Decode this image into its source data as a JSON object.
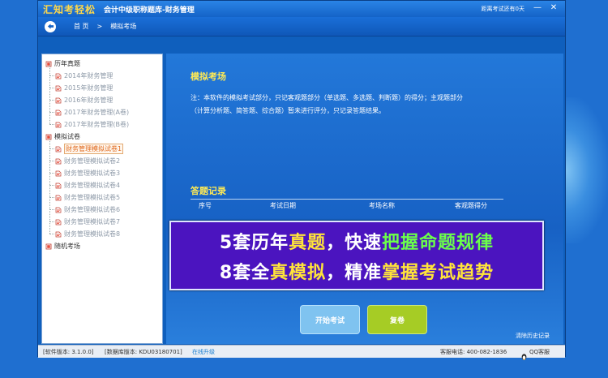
{
  "window": {
    "logo": "汇知考轻松",
    "title": "会计中级职称题库-财务管理",
    "countdown": "距离考试还有0天",
    "minimize_glyph": "—",
    "close_glyph": "✕"
  },
  "breadcrumb": {
    "home": "首 页",
    "separator": ">",
    "current": "模拟考场"
  },
  "sidebar": {
    "groups": [
      {
        "label": "历年真题",
        "items": [
          "2014年财务管理",
          "2015年财务管理",
          "2016年财务管理",
          "2017年财务管理(A卷)",
          "2017年财务管理(B卷)"
        ]
      },
      {
        "label": "模拟试卷",
        "items": [
          "财务管理模拟试卷1",
          "财务管理模拟试卷2",
          "财务管理模拟试卷3",
          "财务管理模拟试卷4",
          "财务管理模拟试卷5",
          "财务管理模拟试卷6",
          "财务管理模拟试卷7",
          "财务管理模拟试卷8"
        ],
        "selected_index": 0
      },
      {
        "label": "随机考场",
        "items": []
      }
    ]
  },
  "main": {
    "section_title": "模拟考场",
    "note_line1": "注：本软件的模拟考试部分，只记客观题部分（单选题、多选题、判断题）的得分；主观题部分",
    "note_line2": "（计算分析题、简答题、综合题）暂未进行评分，只记录答题结果。",
    "records_title": "答题记录",
    "columns": [
      "序号",
      "考试日期",
      "考场名称",
      "客观题得分"
    ],
    "start_button": "开始考试",
    "review_button": "复卷",
    "clear_history": "清除历史记录"
  },
  "banner": {
    "line1": [
      {
        "t": "5套",
        "c": "w"
      },
      {
        "t": "历年",
        "c": "w"
      },
      {
        "t": "真题",
        "c": "y"
      },
      {
        "t": "，快速",
        "c": "w"
      },
      {
        "t": "把握命题规律",
        "c": "g"
      }
    ],
    "line2": [
      {
        "t": "8套",
        "c": "w"
      },
      {
        "t": "全",
        "c": "w"
      },
      {
        "t": "真模拟",
        "c": "y"
      },
      {
        "t": "，精准",
        "c": "w"
      },
      {
        "t": "掌握考试趋势",
        "c": "y"
      }
    ]
  },
  "statusbar": {
    "software_version": "[软件版本: 3.1.0.0]",
    "db_version": "[数据库版本: KDU03180701]",
    "upgrade": "在线升级",
    "service_phone": "客服电话: 400-082-1836",
    "qq": "QQ客服"
  }
}
